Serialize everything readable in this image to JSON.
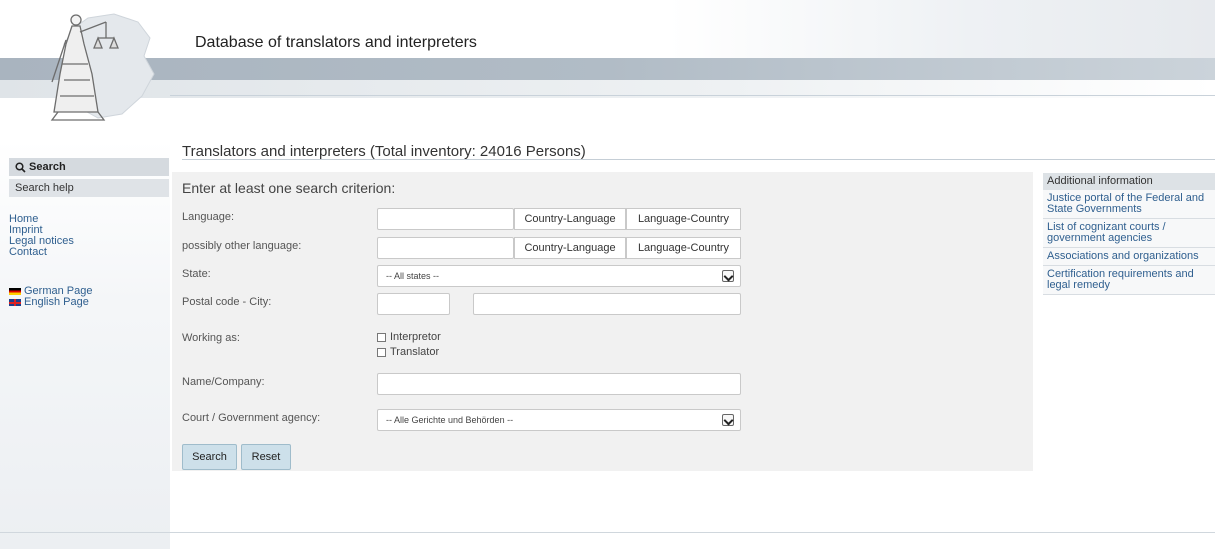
{
  "header": {
    "title": "Database of translators and interpreters",
    "logo_icon": "justitia-germany-map-logo-icon"
  },
  "sidebar": {
    "search_label": "Search",
    "search_icon": "magnifier-icon",
    "search_help_label": "Search help",
    "links": [
      "Home",
      "Imprint",
      "Legal notices",
      "Contact"
    ],
    "languages": [
      {
        "label": "German Page",
        "flag": "german-flag-icon"
      },
      {
        "label": "English Page",
        "flag": "uk-flag-icon"
      }
    ]
  },
  "main": {
    "title": "Translators and interpreters (Total inventory: 24016 Persons)",
    "criterion": "Enter at least one search criterion:",
    "language_label": "Language:",
    "language_value": "",
    "other_language_label": "possibly other language:",
    "other_language_value": "",
    "country_language_btn": "Country-Language",
    "language_country_btn": "Language-Country",
    "state_label": "State:",
    "state_value": "-- All states --",
    "postal_label": "Postal code - City:",
    "postal_value": "",
    "city_value": "",
    "working_as_label": "Working as:",
    "interpretor_label": "Interpretor",
    "translator_label": "Translator",
    "name_label": "Name/Company:",
    "name_value": "",
    "court_label": "Court / Government agency:",
    "court_value": "-- Alle Gerichte und Behörden --",
    "search_btn": "Search",
    "reset_btn": "Reset"
  },
  "right_panel": {
    "heading": "Additional information",
    "items": [
      "Justice portal of the Federal and State Governments",
      "List of cognizant courts / government agencies",
      "Associations and organizations",
      "Certification requirements and legal remedy"
    ]
  },
  "colors": {
    "header_bar": "#b1bcc6",
    "form_panel": "#f1f1f1",
    "link": "#2f5f8f",
    "button": "#cde0ea"
  }
}
